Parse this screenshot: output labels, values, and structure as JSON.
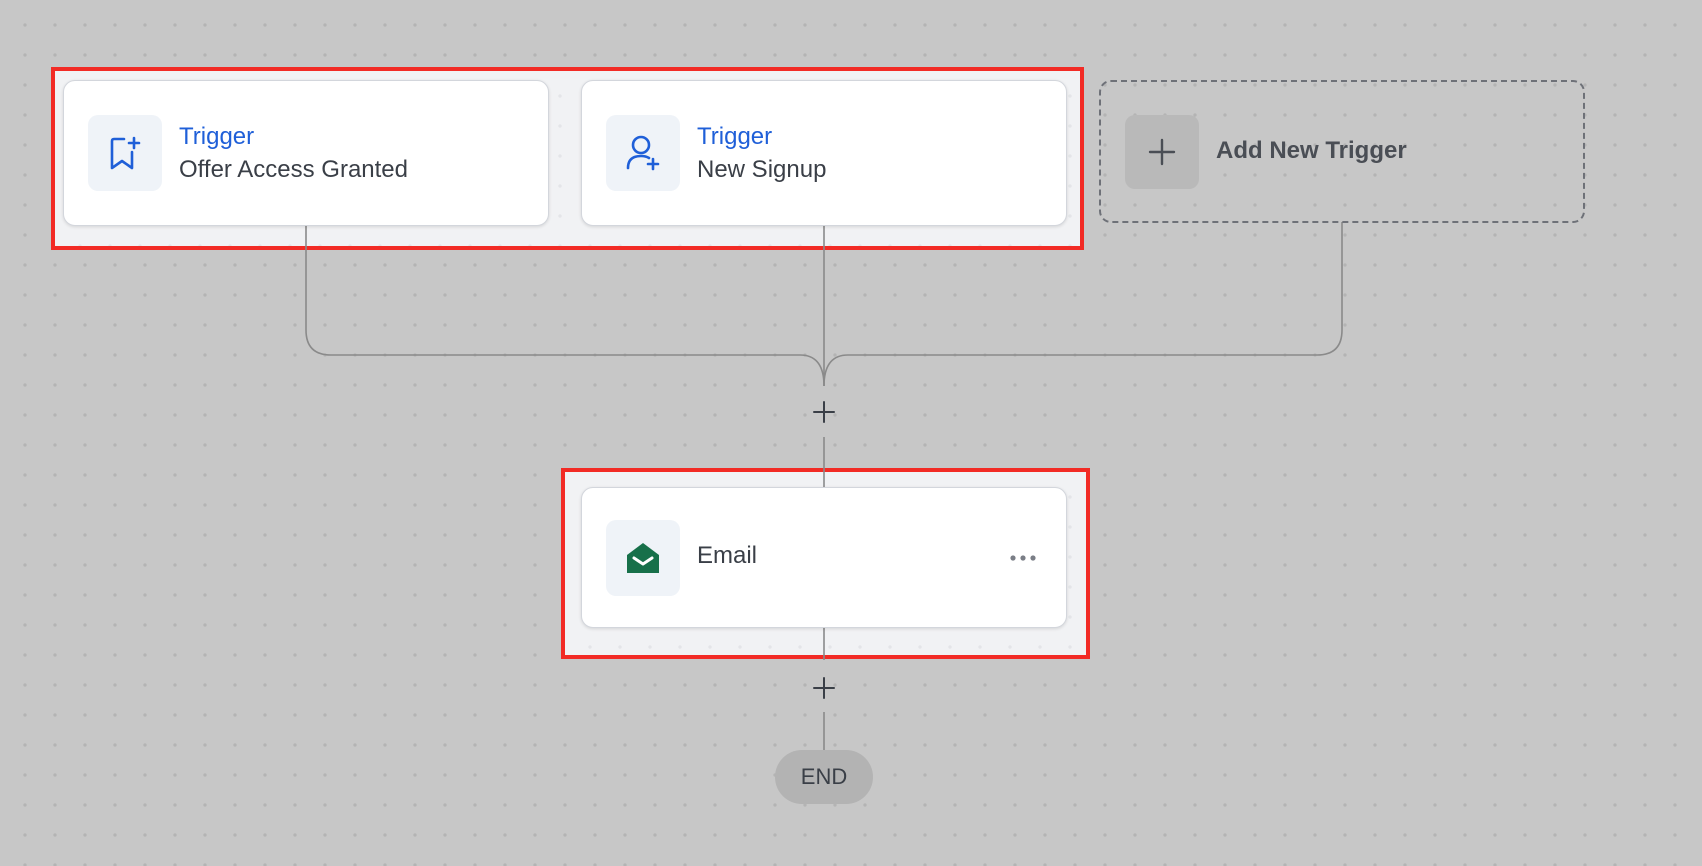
{
  "triggers": [
    {
      "kind": "Trigger",
      "name": "Offer Access Granted",
      "icon": "bookmark-plus-icon"
    },
    {
      "kind": "Trigger",
      "name": "New Signup",
      "icon": "user-plus-icon"
    }
  ],
  "add_trigger": {
    "label": "Add New Trigger",
    "icon": "plus-icon"
  },
  "actions": [
    {
      "name": "Email",
      "icon": "envelope-open-icon",
      "menu_icon": "more-horizontal-icon"
    }
  ],
  "end_label": "END",
  "colors": {
    "canvas": "#c7c7c7",
    "highlight_border": "#f22b25",
    "trigger_accent": "#1f5fd8",
    "email_icon": "#17704a",
    "connector": "#8a8a8a"
  }
}
